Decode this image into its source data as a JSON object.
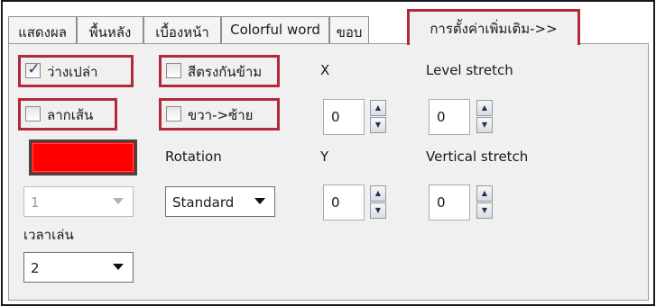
{
  "tabs": [
    {
      "label": "แสดงผล"
    },
    {
      "label": "พื้นหลัง"
    },
    {
      "label": "เบื้องหน้า"
    },
    {
      "label": "Colorful word"
    },
    {
      "label": "ขอบ"
    },
    {
      "label": "การตั้งค่าเพิ่มเติม->>"
    }
  ],
  "active_tab": "การตั้งค่าเพิ่มเติม->>",
  "options": {
    "blank": {
      "label": "ว่างเปล่า",
      "checked": true
    },
    "drag_line": {
      "label": "ลากเส้น",
      "checked": false
    },
    "opposite_color": {
      "label": "สีตรงกันข้าม",
      "checked": false
    },
    "right_to_left": {
      "label": "ขวา->ซ้าย",
      "checked": false
    }
  },
  "check_glyph": "✓",
  "labels": {
    "x": "X",
    "level_stretch": "Level stretch",
    "rotation": "Rotation",
    "y": "Y",
    "vertical_stretch": "Vertical stretch",
    "play_time": "เวลาเล่น"
  },
  "spinners": {
    "x": "0",
    "level_stretch": "0",
    "y": "0",
    "vertical_stretch": "0"
  },
  "combos": {
    "first": {
      "value": "1",
      "disabled": true
    },
    "rotation": {
      "value": "Standard"
    },
    "play_time": {
      "value": "2"
    }
  },
  "colors": {
    "swatch": "#ff0000",
    "highlight": "#b22a3a"
  }
}
